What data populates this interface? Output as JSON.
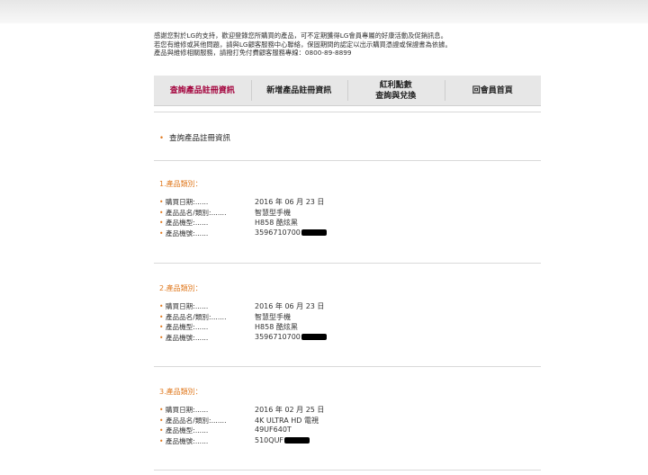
{
  "intro": [
    "感謝您對於LG的支持，歡迎登錄您所購買的產品，可不定期獲得LG會員專屬的好康活動及促銷訊息。",
    "若您有維修或其他問題，請與LG顧客服務中心聯絡，保固期間的認定以出示購買憑證或保證書為依據。",
    "產品與維修相關服務，請撥打免付費顧客服務專線：0800-89-8899"
  ],
  "tabs": [
    {
      "label": "查詢產品註冊資訊",
      "active": true
    },
    {
      "label": "新增產品註冊資訊",
      "active": false
    },
    {
      "label": "紅利點數\n查詢與兌換",
      "active": false
    },
    {
      "label": "回會員首頁",
      "active": false
    }
  ],
  "section_heading": "查詢產品註冊資訊",
  "labels": {
    "purchase_date": "購買日期:......",
    "product_name": "產品品名/類別:.......",
    "model": "產品機型:......",
    "serial": "產品機號:......"
  },
  "products": [
    {
      "title": "1.產品類別：",
      "purchase_date": "2016 年 06 月 23 日",
      "product_name": "智慧型手機",
      "model": "H858 酷炫黑",
      "serial": "3596710700"
    },
    {
      "title": "2.產品類別：",
      "purchase_date": "2016 年 06 月 23 日",
      "product_name": "智慧型手機",
      "model": "H858 酷炫黑",
      "serial": "3596710700"
    },
    {
      "title": "3.產品類別：",
      "purchase_date": "2016 年 02 月 25 日",
      "product_name": "4K ULTRA HD 電視",
      "model": "49UF640T",
      "serial": "510QUF"
    }
  ],
  "colors": {
    "accent_orange": "#e07a20",
    "active_tab": "#a3003b",
    "tab_bg": "#e7e7e7"
  }
}
